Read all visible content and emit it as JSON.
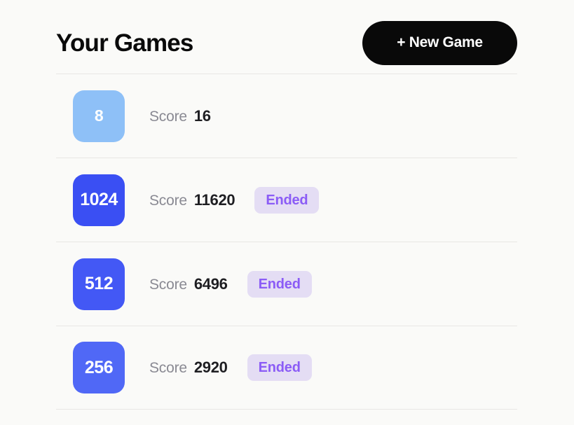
{
  "header": {
    "title": "Your Games",
    "new_game_label": "+ New Game"
  },
  "colors": {
    "background": "#FAFAF8",
    "title_text": "#0A0A0A",
    "button_bg": "#090909",
    "button_text": "#FFFFFF",
    "divider": "#E8E7E4",
    "score_label": "#8A8A93",
    "score_value": "#1E1E22",
    "badge_bg": "#E4DDF4",
    "badge_text": "#8B5CF6"
  },
  "list": {
    "score_label": "Score",
    "rows": [
      {
        "tile_value": "8",
        "tile_color": "#8EC0F7",
        "score": "16",
        "status": ""
      },
      {
        "tile_value": "1024",
        "tile_color": "#3A4FF3",
        "score": "11620",
        "status": "Ended"
      },
      {
        "tile_value": "512",
        "tile_color": "#4358F5",
        "score": "6496",
        "status": "Ended"
      },
      {
        "tile_value": "256",
        "tile_color": "#5068F6",
        "score": "2920",
        "status": "Ended"
      }
    ]
  }
}
